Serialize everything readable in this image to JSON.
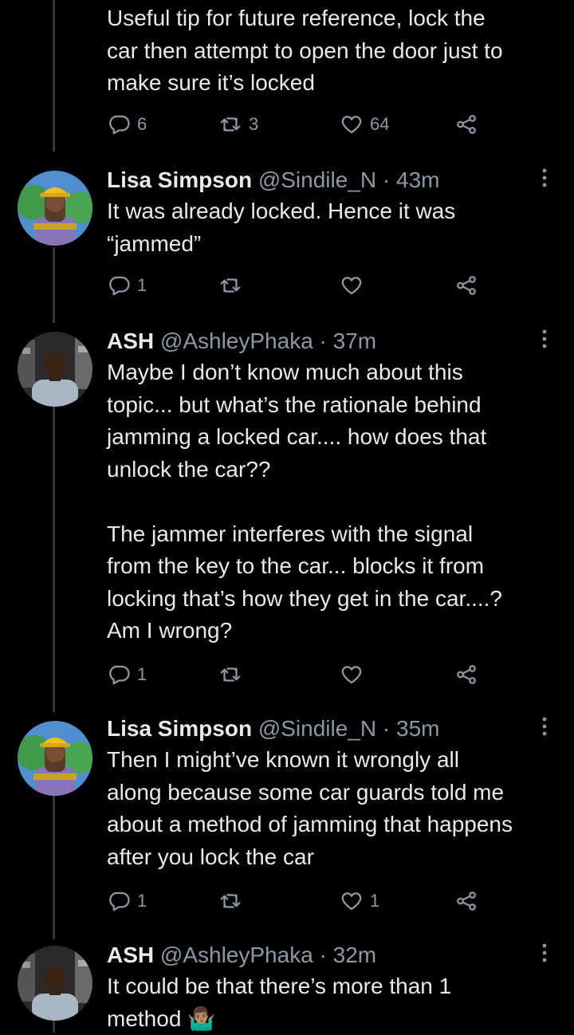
{
  "tweets": [
    {
      "text_lines": [
        "Useful tip for future reference, lock the",
        "car then attempt to open the door just to",
        "make sure it’s locked"
      ],
      "replies": "6",
      "retweets": "3",
      "likes": "64"
    },
    {
      "name": "Lisa Simpson",
      "handle": "@Sindile_N",
      "dot": "·",
      "time": "43m",
      "text_lines": [
        "It was already locked. Hence it was",
        "“jammed”"
      ],
      "replies": "1",
      "retweets": "",
      "likes": ""
    },
    {
      "name": "ASH",
      "handle": "@AshleyPhaka",
      "dot": "·",
      "time": "37m",
      "text_lines": [
        "Maybe I don’t know much about this",
        "topic... but what’s the rationale behind",
        "jamming a locked car.... how does that",
        "unlock the car??",
        "",
        "The jammer interferes with the signal",
        "from the key to the car... blocks it from",
        "locking that’s how they get in the car....?",
        "Am I wrong?"
      ],
      "replies": "1",
      "retweets": "",
      "likes": ""
    },
    {
      "name": "Lisa Simpson",
      "handle": "@Sindile_N",
      "dot": "·",
      "time": "35m",
      "text_lines": [
        "Then I might’ve known it wrongly all",
        "along because some car guards told me",
        "about a method of jamming that happens",
        "after you lock the car"
      ],
      "replies": "1",
      "retweets": "",
      "likes": "1"
    },
    {
      "name": "ASH",
      "handle": "@AshleyPhaka",
      "dot": "·",
      "time": "32m",
      "text_lines": [
        "It could be that there’s more than 1",
        "method 🤷🏽‍♂️"
      ]
    }
  ],
  "icons": {
    "reply": "reply-icon",
    "retweet": "retweet-icon",
    "like": "heart-icon",
    "share": "share-icon",
    "more": "more-vertical-icon"
  },
  "colors": {
    "background": "#000000",
    "text": "#e7e9ea",
    "muted": "#8b98a5",
    "thread_line": "#333639"
  }
}
